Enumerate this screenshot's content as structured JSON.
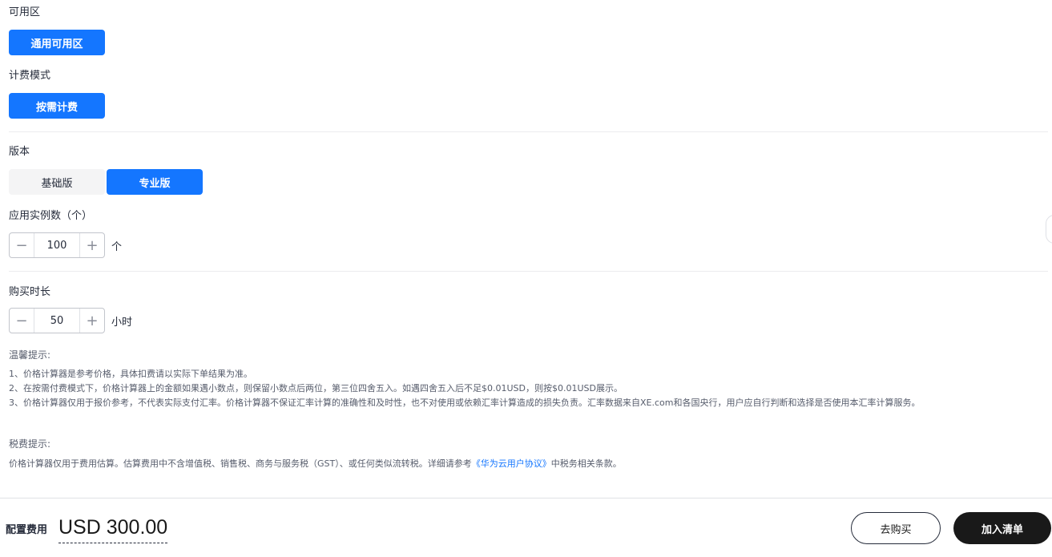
{
  "availability_zone": {
    "label": "可用区",
    "option": "通用可用区"
  },
  "billing_mode": {
    "label": "计费模式",
    "option": "按需计费"
  },
  "edition": {
    "label": "版本",
    "options": [
      "基础版",
      "专业版"
    ],
    "selected": "专业版"
  },
  "instances": {
    "label": "应用实例数（个）",
    "value": "100",
    "unit": "个"
  },
  "duration": {
    "label": "购买时长",
    "value": "50",
    "unit": "小时"
  },
  "tips": {
    "title": "温馨提示:",
    "lines": [
      "1、价格计算器是参考价格，具体扣费请以实际下单结果为准。",
      "2、在按需付费模式下，价格计算器上的金额如果遇小数点，则保留小数点后两位，第三位四舍五入。如遇四舍五入后不足$0.01USD，则按$0.01USD展示。",
      "3、价格计算器仅用于报价参考，不代表实际支付汇率。价格计算器不保证汇率计算的准确性和及时性，也不对使用或依赖汇率计算造成的损失负责。汇率数据来自XE.com和各国央行，用户应自行判断和选择是否使用本汇率计算服务。"
    ]
  },
  "tax": {
    "title": "税费提示:",
    "text_before": "价格计算器仅用于费用估算。估算费用中不含增值税、销售税、商务与服务税（GST）、或任何类似流转税。详细请参考",
    "link": "《华为云用户协议》",
    "text_after": "中税务相关条款。"
  },
  "footer": {
    "price_label": "配置费用",
    "price_value": "USD 300.00",
    "buy_button": "去购买",
    "add_button": "加入清单"
  },
  "colors": {
    "accent": "#1476ff",
    "dark": "#191919",
    "gray_bg": "#f4f4f5"
  }
}
